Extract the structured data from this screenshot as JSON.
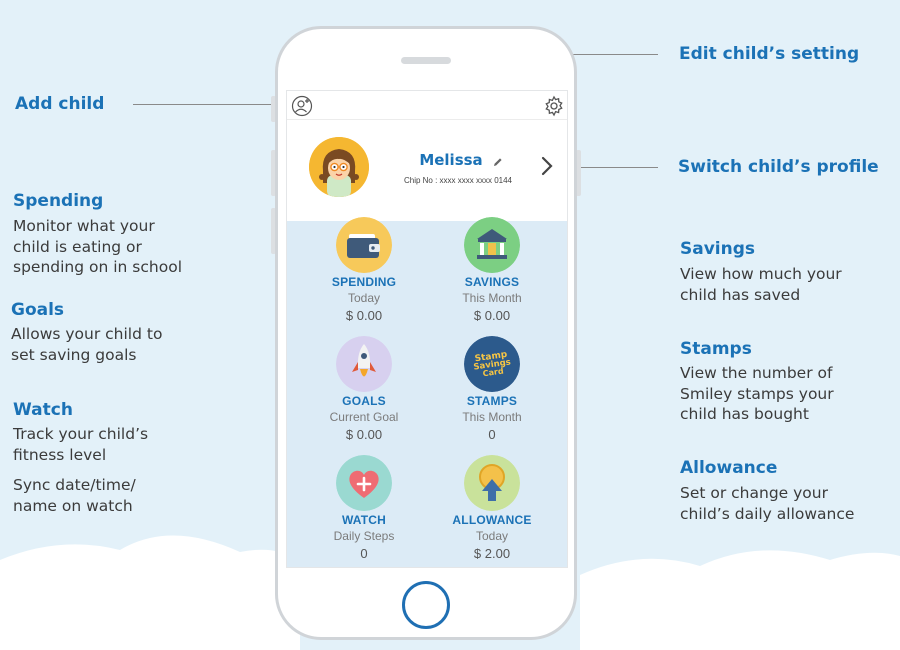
{
  "annotations": {
    "add_child": {
      "title": "Add child"
    },
    "edit_setting": {
      "title": "Edit child’s setting"
    },
    "switch_profile": {
      "title": "Switch child’s profile"
    },
    "spending": {
      "title": "Spending",
      "lines": [
        "Monitor what your",
        "child is eating or",
        "spending on in school"
      ]
    },
    "goals": {
      "title": "Goals",
      "lines": [
        "Allows your child to",
        "set saving goals"
      ]
    },
    "watch": {
      "title": "Watch",
      "lines": [
        "Track your child’s",
        "fitness level"
      ],
      "lines2": [
        "Sync date/time/",
        "name on watch"
      ]
    },
    "savings": {
      "title": "Savings",
      "lines": [
        "View how much your",
        "child has saved"
      ]
    },
    "stamps": {
      "title": "Stamps",
      "lines": [
        "View the number of",
        "Smiley stamps your",
        "child has bought"
      ]
    },
    "allowance": {
      "title": "Allowance",
      "lines": [
        "Set or change your",
        "child’s daily allowance"
      ]
    }
  },
  "app": {
    "child_name": "Melissa",
    "chip_no": "Chip No : xxxx xxxx xxxx 0144",
    "tiles": [
      {
        "label": "SPENDING",
        "sub": "Today",
        "value": "$ 0.00",
        "icon": "wallet-icon",
        "color": "#f7c95a"
      },
      {
        "label": "SAVINGS",
        "sub": "This Month",
        "value": "$ 0.00",
        "icon": "bank-icon",
        "color": "#7ccf83"
      },
      {
        "label": "GOALS",
        "sub": "Current Goal",
        "value": "$ 0.00",
        "icon": "rocket-icon",
        "color": "#d7d0ef"
      },
      {
        "label": "STAMPS",
        "sub": "This Month",
        "value": "0",
        "icon": "stamp-card-icon",
        "color": "#2c5a8c",
        "icon_text": [
          "Stamp",
          "Savings",
          "Card"
        ]
      },
      {
        "label": "WATCH",
        "sub": "Daily Steps",
        "value": "0",
        "icon": "heart-plus-icon",
        "color": "#9ad9d1"
      },
      {
        "label": "ALLOWANCE",
        "sub": "Today",
        "value": "$ 2.00",
        "icon": "coin-arrow-icon",
        "color": "#c9e29b"
      }
    ]
  },
  "colors": {
    "accent": "#1b72b6",
    "background": "#e3f1f9",
    "home_button": "#1f6fb3"
  }
}
